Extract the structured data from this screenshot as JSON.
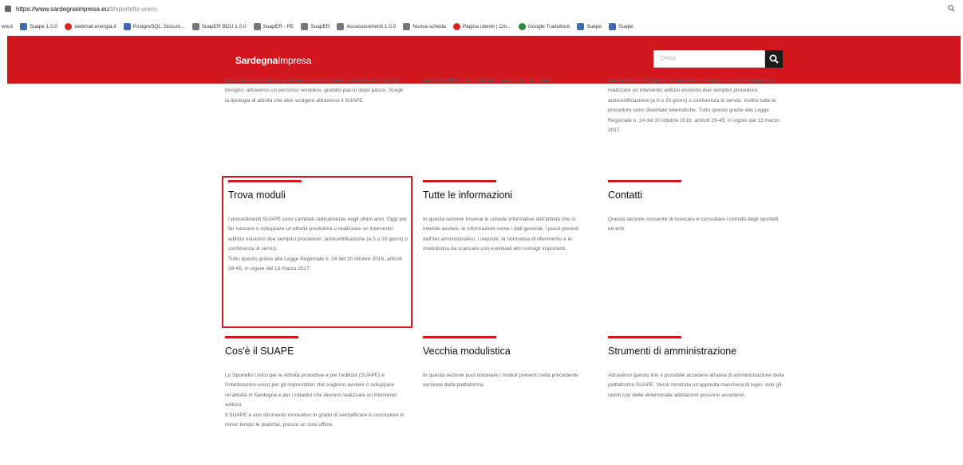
{
  "browser": {
    "url_host": "https://www.sardegnaimpresa.eu",
    "url_path": "/it/sportello-unico",
    "zoom_icon": "magnifier-icon"
  },
  "bookmarks": [
    {
      "label": "ww.it",
      "icon": "folder-icon",
      "color": "#6a8caf"
    },
    {
      "label": "Suape 1.0.0",
      "icon": "flower-icon",
      "color": "#3b6db3"
    },
    {
      "label": "webmail.energia.it",
      "icon": "arc-icon",
      "color": "#d22222"
    },
    {
      "label": "PostgreSQL: Docum...",
      "icon": "elephant-icon",
      "color": "#3b6db3"
    },
    {
      "label": "SuapER BDU 1.0.0",
      "icon": "gear-icon",
      "color": "#777777"
    },
    {
      "label": "SuapER - PE",
      "icon": "gear-icon",
      "color": "#777777"
    },
    {
      "label": "SuapER",
      "icon": "grid-icon",
      "color": "#777777"
    },
    {
      "label": "Accessionmenti 1.0.0",
      "icon": "grid-icon",
      "color": "#777777"
    },
    {
      "label": "Nuova scheda",
      "icon": "gear-icon",
      "color": "#777777"
    },
    {
      "label": "Pagina utente | Cm...",
      "icon": "star-icon",
      "color": "#d22222"
    },
    {
      "label": "Google Traduttore",
      "icon": "dot-icon",
      "color": "#2a8a3a"
    },
    {
      "label": "Suape",
      "icon": "flower-icon",
      "color": "#3b6db3"
    },
    {
      "label": "Suape",
      "icon": "flower-icon",
      "color": "#3b6db3"
    }
  ],
  "header": {
    "logo_bold": "Sardegna",
    "logo_light": "Impresa",
    "search_placeholder": "Cerca",
    "brand_color": "#d1161d"
  },
  "top_snippets": {
    "left": "In questa sezione riuscirai facilmente a individuare la modulistica di cui hai bisogno, attraverso un percorso semplice, guidato passo dopo passo. Scegli la tipologia di attività che devi svolgere attraverso il SUAPE.",
    "center": "unico SUAPE e sulle modifiche e integrazioni ai moduli.",
    "right": "negli ultimi anni. Oggi per far nascere o sviluppare un'attività produttiva o realizzare un intervento edilizio esistono due semplici procedure: autocertificazione (a 0 o 20 giorni) o conferenza di servizi. Inoltre tutte le procedure sono diventate telematiche. Tutto questo grazie alla Legge Regionale n. 24 del 20 ottobre 2016, articoli 29-45, in vigore dal 13 marzo 2017."
  },
  "cards": [
    {
      "title": "Trova moduli",
      "text": "I procedimenti SUAPE sono cambiati radicalmente negli ultimi anni. Oggi per far nascere o sviluppare un'attività produttiva o realizzare un intervento edilizio esistono due semplici procedure: autocertificazione (a 0 o 20 giorni) o conferenza di servizi.\nTutto questo grazie alla Legge Regionale n. 24 del 20 ottobre 2016, articoli 29-45, in vigore dal 13 marzo 2017."
    },
    {
      "title": "Tutte le informazioni",
      "text": "In questa sezione troverai le schede informative dell'attività che si intende avviare, le informazioni come i dati generali, i passi previsti dall'iter amministrativo, i requisiti, la normativa di riferimento e la modulistica da scaricare con eventuali altri consigli importanti."
    },
    {
      "title": "Contatti",
      "text": "Questa sezione consente di ricercare e consultare i contatti degli sportelli ed enti."
    },
    {
      "title": "Cos'è il SUAPE",
      "text": "Lo Sportello Unico per le Attività produttive e per l'edilizia (SUAPE) è l'interlocutore unico per gli imprenditori che vogliono avviare o sviluppare un'attività in Sardegna e per i cittadini che devono realizzare un intervento edilizio.\nIl SUAPE è uno strumento innovativo in grado di semplificare e concludere in minor tempo le pratiche, presso un solo ufficio."
    },
    {
      "title": "Vecchia modulistica",
      "text": "In questa sezione puoi visionare i moduli presenti nella precedente versione della piattaforma."
    },
    {
      "title": "Strumenti di amministrazione",
      "text": "Attraverso questo link è possibile accedere all'area di amministrazione della piattaforma SUAPE. Verrà mostrata un'apposita maschera di login, solo gli utenti con delle determinate abilitazioni possono accedervi."
    }
  ]
}
